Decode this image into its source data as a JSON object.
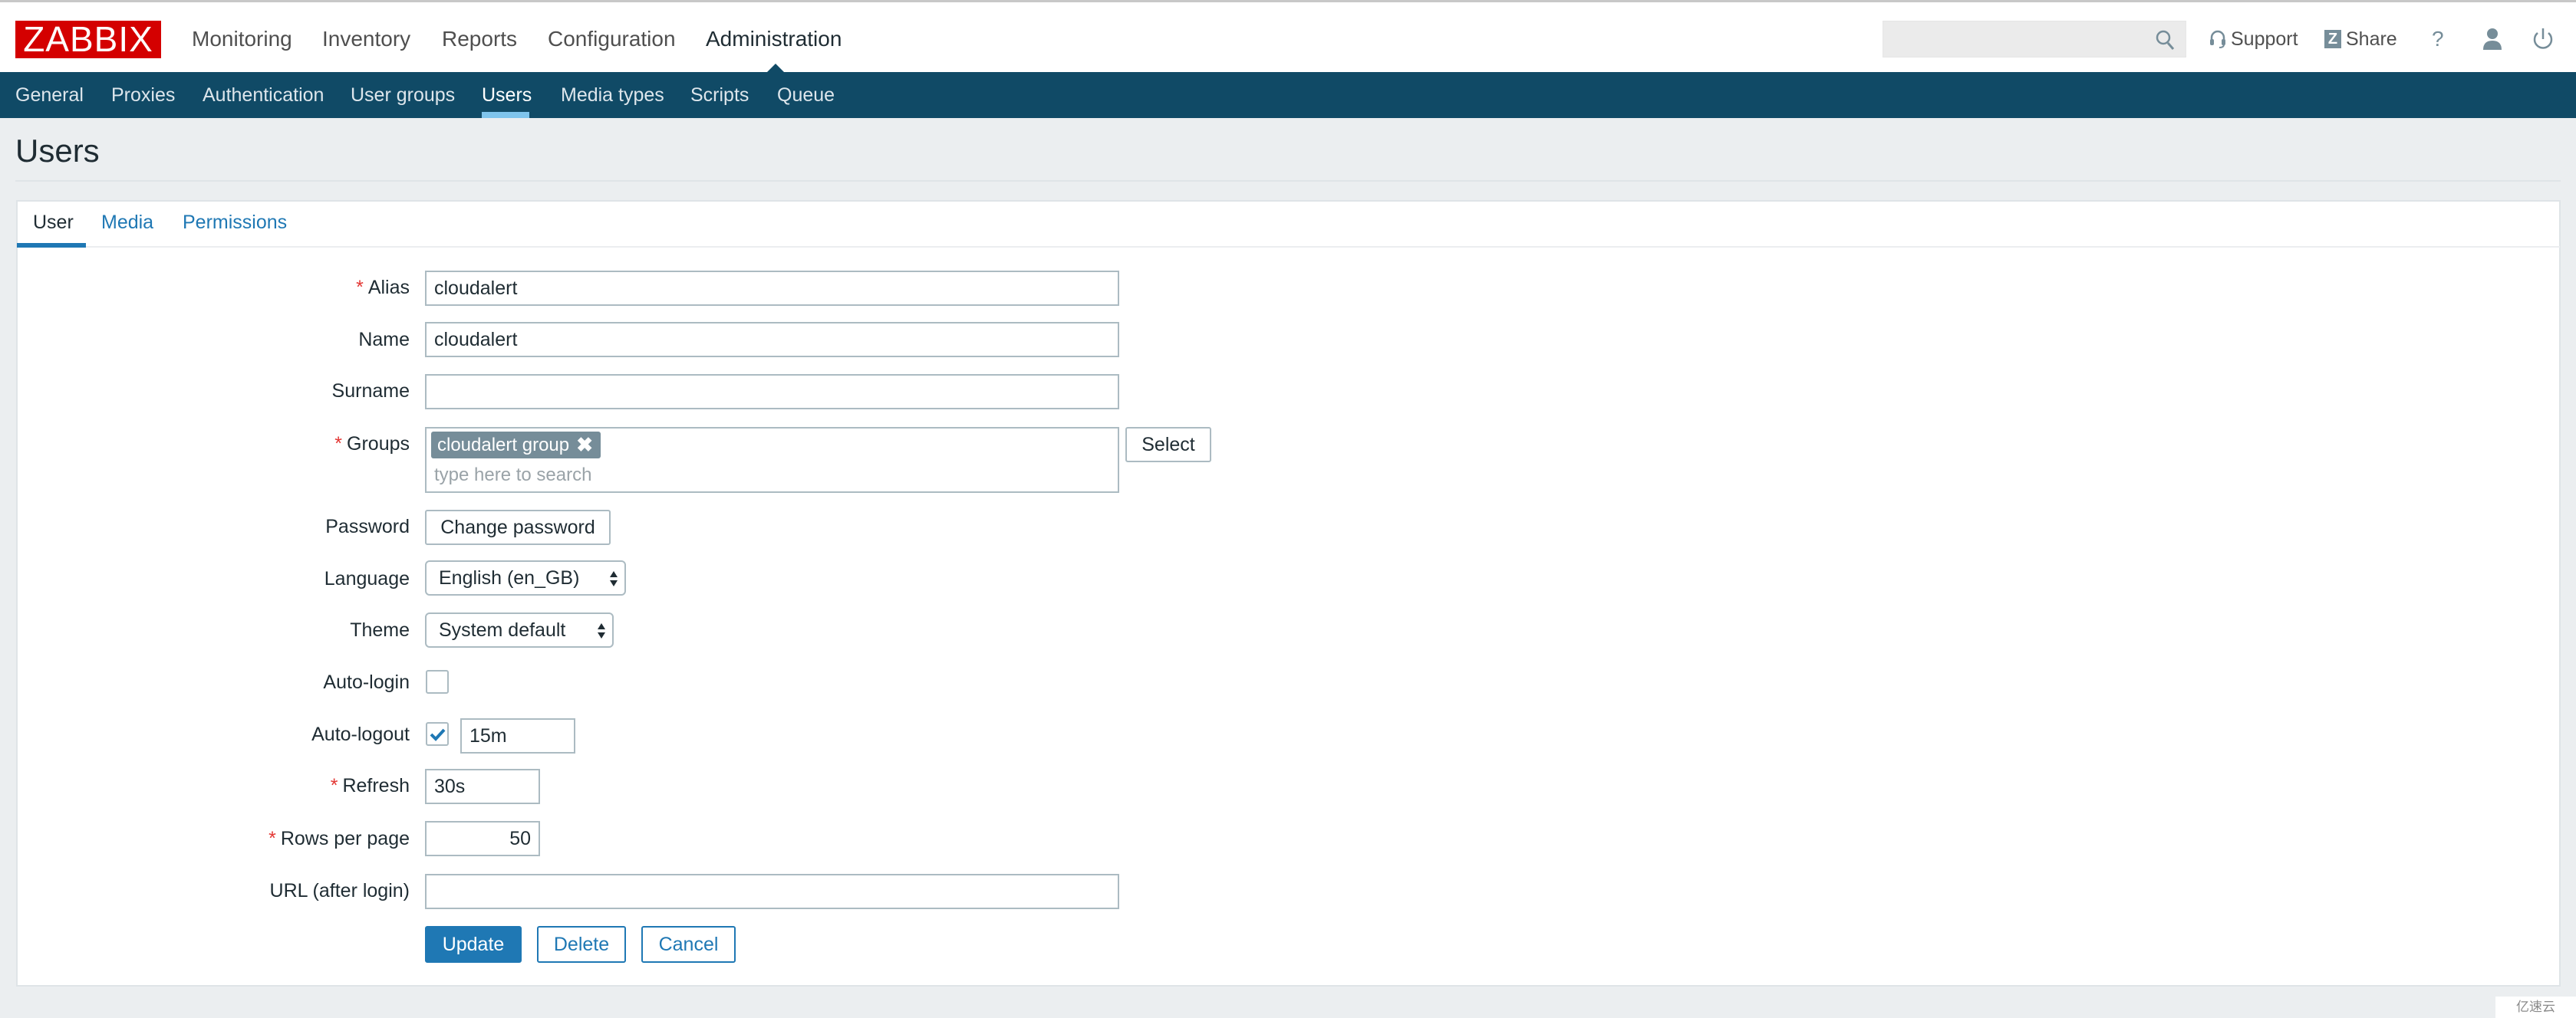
{
  "header": {
    "logo": "ZABBIX",
    "main_nav": [
      {
        "label": "Monitoring"
      },
      {
        "label": "Inventory"
      },
      {
        "label": "Reports"
      },
      {
        "label": "Configuration"
      },
      {
        "label": "Administration",
        "active": true
      }
    ],
    "search": {
      "value": "",
      "placeholder": ""
    },
    "support_label": "Support",
    "share_label": "Share",
    "share_badge": "Z",
    "help_label": "?"
  },
  "sub_nav": [
    {
      "label": "General"
    },
    {
      "label": "Proxies"
    },
    {
      "label": "Authentication"
    },
    {
      "label": "User groups"
    },
    {
      "label": "Users",
      "active": true
    },
    {
      "label": "Media types"
    },
    {
      "label": "Scripts"
    },
    {
      "label": "Queue"
    }
  ],
  "page": {
    "title": "Users"
  },
  "tabs": [
    {
      "label": "User",
      "active": true
    },
    {
      "label": "Media"
    },
    {
      "label": "Permissions"
    }
  ],
  "form": {
    "required_mark": "*",
    "alias": {
      "label": "Alias",
      "value": "cloudalert",
      "required": true
    },
    "name": {
      "label": "Name",
      "value": "cloudalert"
    },
    "surname": {
      "label": "Surname",
      "value": ""
    },
    "groups": {
      "label": "Groups",
      "required": true,
      "selected": [
        {
          "label": "cloudalert group",
          "remove": "✖"
        }
      ],
      "placeholder": "type here to search",
      "select_button": "Select"
    },
    "password": {
      "label": "Password",
      "button": "Change password"
    },
    "language": {
      "label": "Language",
      "value": "English (en_GB)"
    },
    "theme": {
      "label": "Theme",
      "value": "System default"
    },
    "auto_login": {
      "label": "Auto-login",
      "checked": false
    },
    "auto_logout": {
      "label": "Auto-logout",
      "checked": true,
      "value": "15m"
    },
    "refresh": {
      "label": "Refresh",
      "value": "30s",
      "required": true
    },
    "rows_per_page": {
      "label": "Rows per page",
      "value": "50",
      "required": true
    },
    "url": {
      "label": "URL (after login)",
      "value": ""
    }
  },
  "actions": {
    "update": "Update",
    "delete": "Delete",
    "cancel": "Cancel"
  },
  "colors": {
    "brand_red": "#d40000",
    "nav_blue": "#104a66",
    "accent_blue": "#1f78b4",
    "required_red": "#e33734",
    "tag_gray": "#768d99"
  },
  "watermark": "亿速云"
}
